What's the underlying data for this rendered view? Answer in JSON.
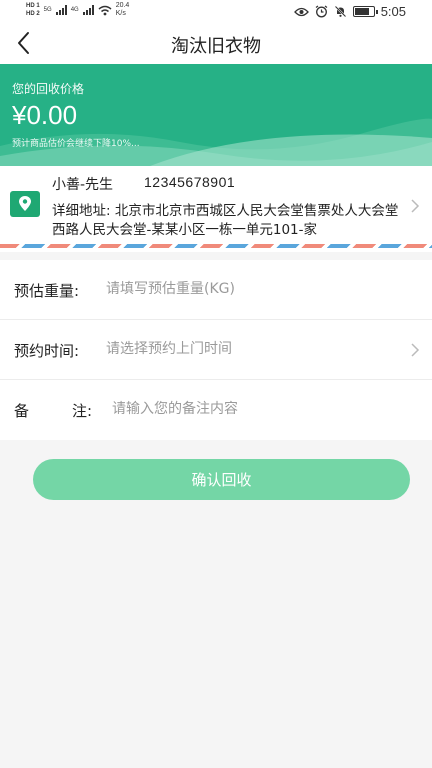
{
  "status_bar": {
    "hd1": "HD 1",
    "hd2": "HD 2",
    "net1": "5G",
    "net2": "4G",
    "speed": "20.4",
    "speed_unit": "K/s",
    "time": "5:05"
  },
  "nav": {
    "title": "淘汰旧衣物",
    "back_icon": "chevron-left-icon"
  },
  "price": {
    "label": "您的回收价格",
    "value": "¥0.00",
    "note": "预计商品估价会继续下降10%..."
  },
  "address": {
    "name": "小善-先生",
    "phone": "12345678901",
    "detail": "详细地址: 北京市北京市西城区人民大会堂售票处人大会堂西路人民大会堂-某某小区一栋一单元101-家"
  },
  "form": {
    "weight": {
      "label": "预估重量:",
      "placeholder": "请填写预估重量(KG)"
    },
    "time": {
      "label": "预约时间:",
      "placeholder": "请选择预约上门时间"
    },
    "remark": {
      "label_a": "备",
      "label_b": "注:",
      "placeholder": "请输入您的备注内容"
    }
  },
  "button": {
    "label": "确认回收"
  },
  "colors": {
    "accent": "#26b186",
    "button": "#74d6a6"
  }
}
